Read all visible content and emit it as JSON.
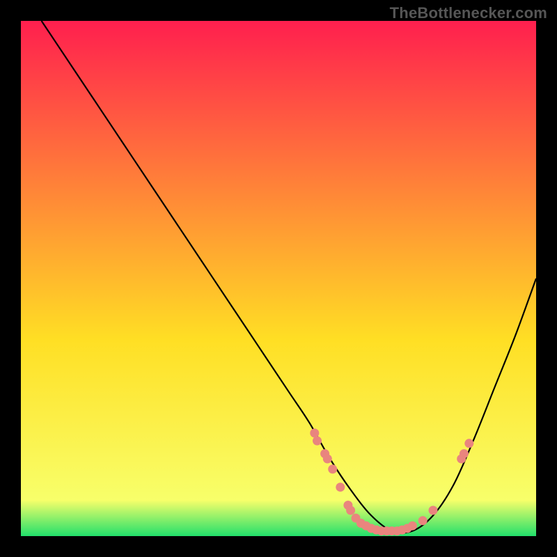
{
  "attribution": "TheBottlenecker.com",
  "colors": {
    "grad_top": "#ff1f4e",
    "grad_mid": "#ffdf24",
    "grad_bottom": "#22e06b",
    "frame": "#000000",
    "curve": "#000000",
    "dot_fill": "#e9857e",
    "attribution": "#565656"
  },
  "chart_data": {
    "type": "line",
    "title": "",
    "xlabel": "",
    "ylabel": "",
    "xlim": [
      0,
      100
    ],
    "ylim": [
      0,
      100
    ],
    "series": [
      {
        "name": "bottleneck-curve",
        "x": [
          4,
          10,
          16,
          22,
          28,
          34,
          40,
          46,
          52,
          56,
          60,
          64,
          68,
          72,
          76,
          80,
          84,
          88,
          92,
          96,
          100
        ],
        "y": [
          100,
          91,
          82,
          73,
          64,
          55,
          46,
          37,
          28,
          22,
          15,
          9,
          4,
          1,
          1,
          4,
          10,
          19,
          29,
          39,
          50
        ]
      }
    ],
    "points": [
      {
        "x": 57,
        "y": 20
      },
      {
        "x": 57.5,
        "y": 18.5
      },
      {
        "x": 59,
        "y": 16
      },
      {
        "x": 59.5,
        "y": 15
      },
      {
        "x": 60.5,
        "y": 13
      },
      {
        "x": 62,
        "y": 9.5
      },
      {
        "x": 63.5,
        "y": 6
      },
      {
        "x": 64,
        "y": 5
      },
      {
        "x": 65,
        "y": 3.5
      },
      {
        "x": 66,
        "y": 2.5
      },
      {
        "x": 67,
        "y": 2
      },
      {
        "x": 68,
        "y": 1.5
      },
      {
        "x": 69,
        "y": 1.2
      },
      {
        "x": 70,
        "y": 1
      },
      {
        "x": 71,
        "y": 1
      },
      {
        "x": 72,
        "y": 1
      },
      {
        "x": 73,
        "y": 1
      },
      {
        "x": 74,
        "y": 1.2
      },
      {
        "x": 75,
        "y": 1.5
      },
      {
        "x": 76,
        "y": 2
      },
      {
        "x": 78,
        "y": 3
      },
      {
        "x": 80,
        "y": 5
      },
      {
        "x": 85.5,
        "y": 15
      },
      {
        "x": 86,
        "y": 16
      },
      {
        "x": 87,
        "y": 18
      }
    ]
  }
}
